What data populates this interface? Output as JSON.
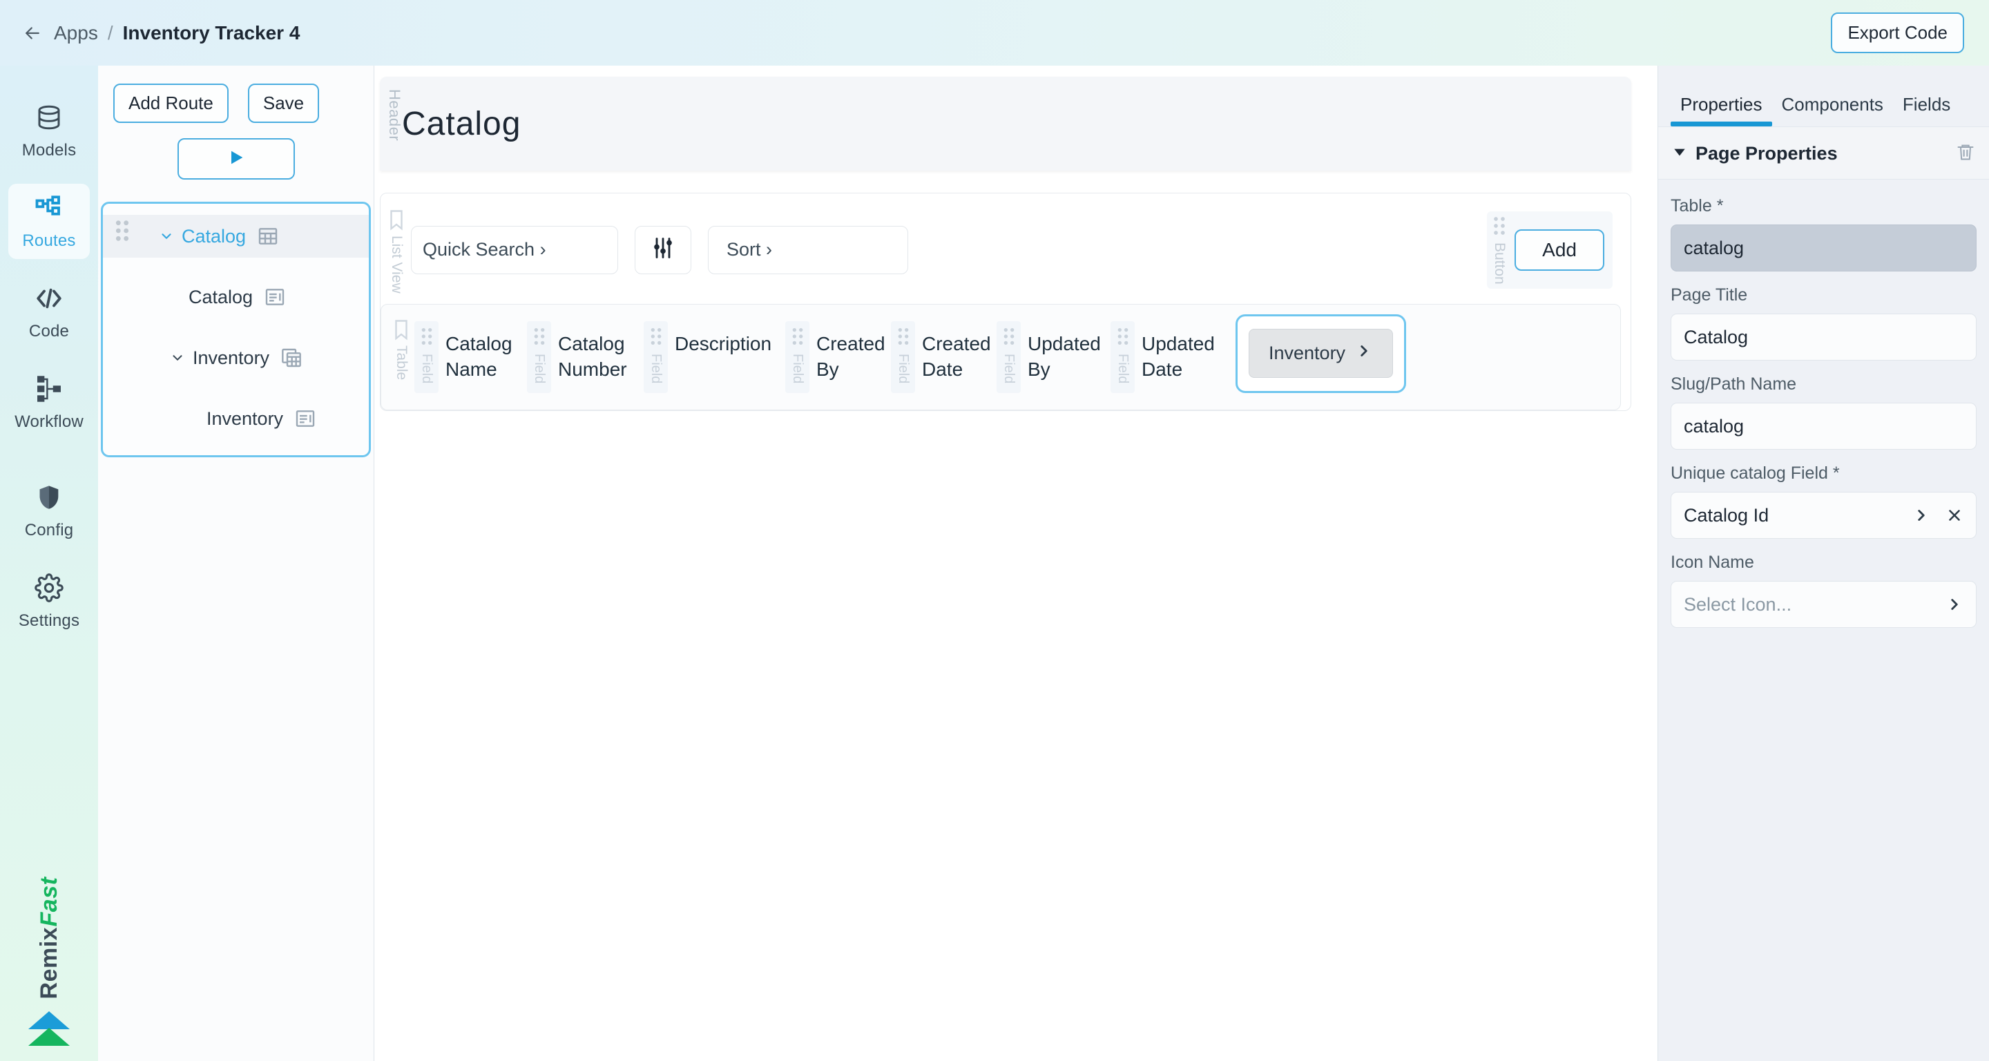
{
  "topbar": {
    "back_icon": "arrow-left-icon",
    "breadcrumb_root": "Apps",
    "breadcrumb_separator": "/",
    "breadcrumb_current": "Inventory Tracker 4",
    "export_label": "Export Code"
  },
  "rail": {
    "items": [
      {
        "label": "Models",
        "icon": "database-icon",
        "active": false
      },
      {
        "label": "Routes",
        "icon": "sitemap-icon",
        "active": true
      },
      {
        "label": "Code",
        "icon": "code-brackets-icon",
        "active": false
      },
      {
        "label": "Workflow",
        "icon": "workflow-icon",
        "active": false
      },
      {
        "label": "Config",
        "icon": "shield-icon",
        "active": false
      },
      {
        "label": "Settings",
        "icon": "gear-icon",
        "active": false
      }
    ],
    "brand_first": "Remix",
    "brand_second": "Fast"
  },
  "routes": {
    "add_route_label": "Add Route",
    "save_label": "Save",
    "run_icon": "play-icon",
    "tree": [
      {
        "label": "Catalog",
        "icon": "table-grid-icon",
        "indent": 0,
        "chevron": "chevron-down-icon",
        "selected": true,
        "accent": true
      },
      {
        "label": "Catalog",
        "icon": "list-detail-icon",
        "indent": 1,
        "chevron": "",
        "selected": false,
        "accent": false
      },
      {
        "label": "Inventory",
        "icon": "tables-copy-icon",
        "indent": 1,
        "chevron": "chevron-down-icon",
        "selected": false,
        "accent": false
      },
      {
        "label": "Inventory",
        "icon": "list-detail-icon",
        "indent": 2,
        "chevron": "",
        "selected": false,
        "accent": false
      }
    ]
  },
  "canvas": {
    "header_slot_label": "Header",
    "page_title": "Catalog",
    "listview_slot_label": "List View",
    "listview_icon": "bookmark-icon",
    "quick_search_label": "Quick Search ›",
    "filter_icon": "sliders-icon",
    "sort_label": "Sort ›",
    "button_slot_label": "Button",
    "add_label": "Add",
    "table_slot_label": "Table",
    "table_icon": "bookmark-icon",
    "field_slot_label": "Field",
    "columns": [
      "Catalog Name",
      "Catalog Number",
      "Description",
      "Created By",
      "Created Date",
      "Updated By",
      "Updated Date"
    ],
    "relation_button_label": "Inventory",
    "relation_button_icon": "chevron-right-icon"
  },
  "properties": {
    "tabs": [
      {
        "label": "Properties",
        "active": true
      },
      {
        "label": "Components",
        "active": false
      },
      {
        "label": "Fields",
        "active": false
      }
    ],
    "section_title": "Page Properties",
    "section_collapse_icon": "triangle-down-icon",
    "section_delete_icon": "trash-icon",
    "fields": [
      {
        "label": "Table *",
        "value": "catalog",
        "disabled": true,
        "chevron": false,
        "clear": false
      },
      {
        "label": "Page Title",
        "value": "Catalog",
        "disabled": false,
        "chevron": false,
        "clear": false
      },
      {
        "label": "Slug/Path Name",
        "value": "catalog",
        "disabled": false,
        "chevron": false,
        "clear": false
      },
      {
        "label": "Unique catalog Field *",
        "value": "Catalog Id",
        "disabled": false,
        "chevron": true,
        "clear": true
      },
      {
        "label": "Icon Name",
        "value": "Select Icon...",
        "placeholder": true,
        "disabled": false,
        "chevron": true,
        "clear": false
      }
    ]
  },
  "colors": {
    "accent_blue": "#36a8e0",
    "active_tab_underline": "#1897d4",
    "brand_green": "#15b55e",
    "selection_border": "#6ec6ef"
  }
}
